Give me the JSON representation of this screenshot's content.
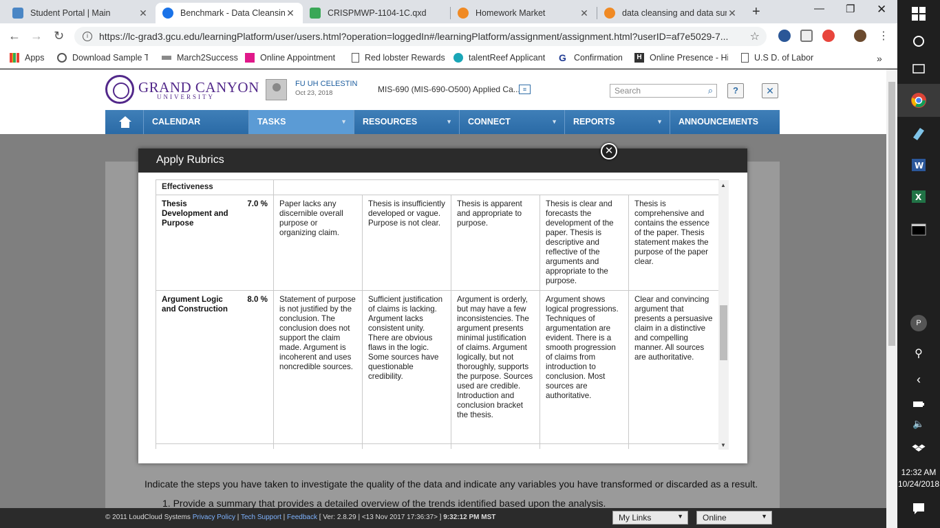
{
  "browser": {
    "tabs": [
      {
        "title": "Student Portal | Main",
        "active": false
      },
      {
        "title": "Benchmark - Data Cleansing",
        "active": true
      },
      {
        "title": "CRISPMWP-1104-1C.qxd",
        "active": false
      },
      {
        "title": "Homework Market",
        "active": false
      },
      {
        "title": "data cleansing and data sum",
        "active": false
      }
    ],
    "url": "https://lc-grad3.gcu.edu/learningPlatform/user/users.html?operation=loggedIn#/learningPlatform/assignment/assignment.html?userID=af7e5029-7...",
    "bookmarks": [
      "Apps",
      "Download Sample Te",
      "March2Success",
      "Online Appointment",
      "Red lobster Rewards",
      "talentReef Applicant",
      "Confirmation",
      "Online Presence - Hir",
      "U.S D. of Labor"
    ]
  },
  "site": {
    "logo_main": "GRAND CANYON",
    "logo_sub": "UNIVERSITY",
    "user_name": "FU UH CELESTIN",
    "user_date": "Oct 23, 2018",
    "course": "MIS-690 (MIS-690-O500) Applied Ca...",
    "search_placeholder": "Search",
    "help": "?",
    "close": "✕",
    "nav": [
      "CALENDAR",
      "TASKS",
      "RESOURCES",
      "CONNECT",
      "REPORTS",
      "ANNOUNCEMENTS"
    ],
    "bg_line1": "Indicate the steps you have taken to investigate the quality of the data and indicate any variables you have transformed or discarded as a result.",
    "bg_line2": "1. Provide a summary that provides a detailed overview of the trends identified based upon the analysis."
  },
  "modal": {
    "title": "Apply Rubrics",
    "header_row": "Effectiveness",
    "rows": [
      {
        "criterion": "Thesis Development and Purpose",
        "weight": "7.0 %",
        "levels": [
          "Paper lacks any discernible overall purpose or organizing claim.",
          "Thesis is insufficiently developed or vague. Purpose is not clear.",
          "Thesis is apparent and appropriate to purpose.",
          "Thesis is clear and forecasts the development of the paper. Thesis is descriptive and reflective of the arguments and appropriate to the purpose.",
          "Thesis is comprehensive and contains the essence of the paper. Thesis statement makes the purpose of the paper clear."
        ]
      },
      {
        "criterion": "Argument Logic and Construction",
        "weight": "8.0 %",
        "levels": [
          "Statement of purpose is not justified by the conclusion. The conclusion does not support the claim made. Argument is incoherent and uses noncredible sources.",
          "Sufficient justification of claims is lacking. Argument lacks consistent unity. There are obvious flaws in the logic. Some sources have questionable credibility.",
          "Argument is orderly, but may have a few inconsistencies. The argument presents minimal justification of claims. Argument logically, but not thoroughly, supports the purpose. Sources used are credible. Introduction and conclusion bracket the thesis.",
          "Argument shows logical progressions. Techniques of argumentation are evident. There is a smooth progression of claims from introduction to conclusion. Most sources are authoritative.",
          "Clear and convincing argument that presents a persuasive claim in a distinctive and compelling manner. All sources are authoritative."
        ]
      }
    ]
  },
  "footer": {
    "copyright": "© 2011 LoudCloud Systems",
    "privacy": "Privacy Policy",
    "tech": "Tech Support",
    "feedback": "Feedback",
    "version": "[ Ver: 2.8.29 | <13 Nov 2017 17:36:37> ]",
    "time": "9:32:12 PM MST",
    "mylinks": "My Links",
    "status": "Online"
  },
  "taskbar": {
    "avatar_letter": "P",
    "time": "12:32 AM",
    "date": "10/24/2018"
  },
  "colors": {
    "nav": "#3474b0",
    "brand_purple": "#52288a",
    "modal_header": "#2b2b2b"
  }
}
